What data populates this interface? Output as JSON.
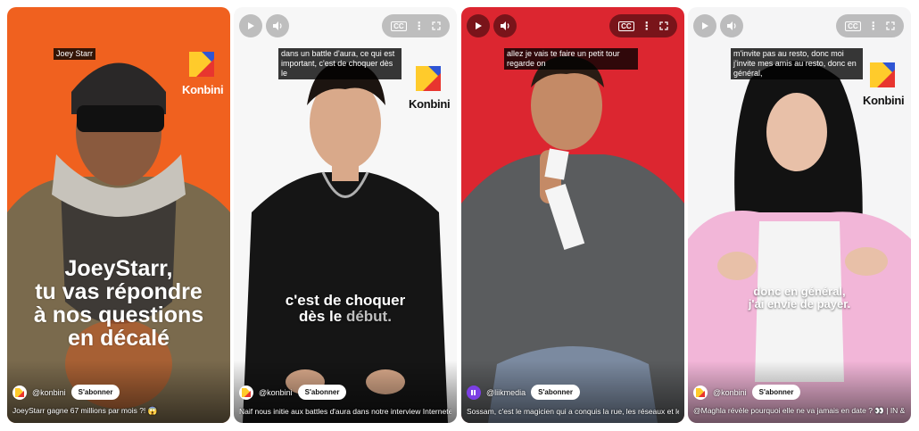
{
  "shorts": [
    {
      "top_caption": "Joey Starr",
      "overlay_text": "JoeyStarr,\ntu vas répondre\nà nos questions\nen décalé",
      "channel": "@konbini",
      "subscribe_label": "S'abonner",
      "title": "JoeyStarr gagne 67 millions par mois ?! 😱",
      "logo_text": "Konbini",
      "bg_color": "#f0611f"
    },
    {
      "top_caption": "dans un battle d'aura, ce qui est important, c'est de choquer dès le",
      "overlay_text_main": "c'est de choquer",
      "overlay_text_line2a": "dès le ",
      "overlay_text_line2b": "début.",
      "channel": "@konbini",
      "subscribe_label": "S'abonner",
      "title": "Naif nous initie aux battles d'aura dans notre interview Interneteur...",
      "logo_text": "Konbini",
      "bg_color": "#f7f7f7"
    },
    {
      "top_caption": "allez je vais te faire un petit tour regarde on",
      "channel": "@liikmedia",
      "subscribe_label": "S'abonner",
      "title": "Sossam, c'est le magicien qui a conquis la rue, les réseaux et les stars av...",
      "bg_color": "#dc2630"
    },
    {
      "top_caption": "m'invite pas au resto, donc moi j'invite mes amis au resto, donc en général,",
      "overlay_text_line1": "donc en général,",
      "overlay_text_line2": "j'ai envie de payer.",
      "channel": "@konbini",
      "subscribe_label": "S'abonner",
      "title": "@Maghla révèle pourquoi elle ne va jamais en date ? 👀 | IN & OUT",
      "logo_text": "Konbini",
      "bg_color": "#f5f5f6"
    }
  ],
  "controls": {
    "cc_label": "CC",
    "more_symbol": "⋮"
  },
  "icons": [
    "play-icon",
    "volume-icon",
    "more-icon",
    "fullscreen-icon",
    "konbini-logo"
  ]
}
